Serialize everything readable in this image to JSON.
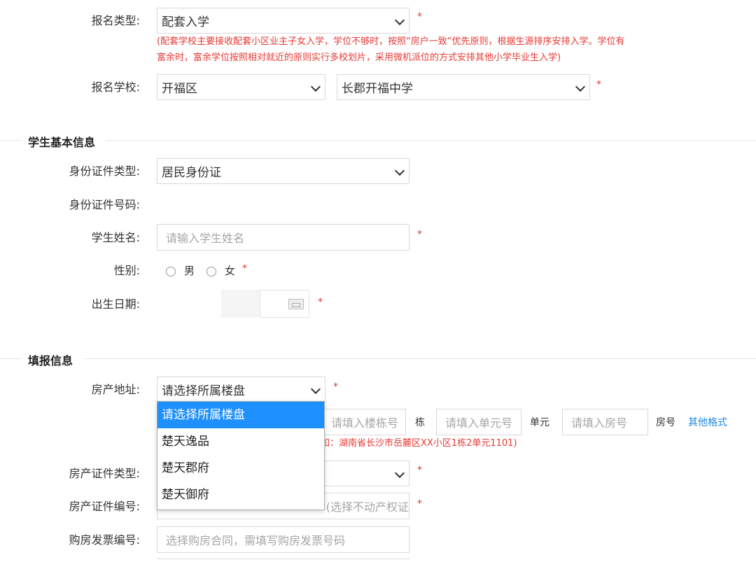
{
  "enroll": {
    "type_label": "报名类型:",
    "type_value": "配套入学",
    "note_line1": "(配套学校主要接收配套小区业主子女入学，学位不够时，按照“房户一致”优先原则，根据生源排序安排入学。学位有",
    "note_line2": "富余时，富余学位按照相对就近的原则实行多校划片，采用微机派位的方式安排其他小学毕业生入学)",
    "school_label": "报名学校:",
    "district_value": "开福区",
    "school_value": "长郡开福中学"
  },
  "student": {
    "section_title": "学生基本信息",
    "id_type_label": "身份证件类型:",
    "id_type_value": "居民身份证",
    "id_number_label": "身份证件号码:",
    "name_label": "学生姓名:",
    "name_placeholder": "请输入学生姓名",
    "gender_label": "性别:",
    "gender_male": "男",
    "gender_female": "女",
    "birth_label": "出生日期:"
  },
  "fill": {
    "section_title": "填报信息",
    "address_label": "房产地址:",
    "address_value": "请选择所属楼盘",
    "building_placeholder": "请填入楼栋号",
    "building_unit": "栋",
    "unit_placeholder": "请填入单元号",
    "unit_unit": "单元",
    "room_placeholder": "请填入房号",
    "room_unit": "房号",
    "other_format_link": "其他格式",
    "example_text": "如：湖南省长沙市岳麓区XX小区1栋2单元1101)",
    "cert_type_label": "房产证件类型:",
    "cert_number_label": "房产证件编号:",
    "cert_number_placeholder": "(选择不动产权证",
    "invoice_label": "购房发票编号:",
    "invoice_placeholder": "选择购房合同，需填写购房发票号码"
  },
  "dropdown": {
    "options": [
      "请选择所属楼盘",
      "楚天逸品",
      "楚天郡府",
      "楚天御府"
    ]
  },
  "required_mark": "*"
}
